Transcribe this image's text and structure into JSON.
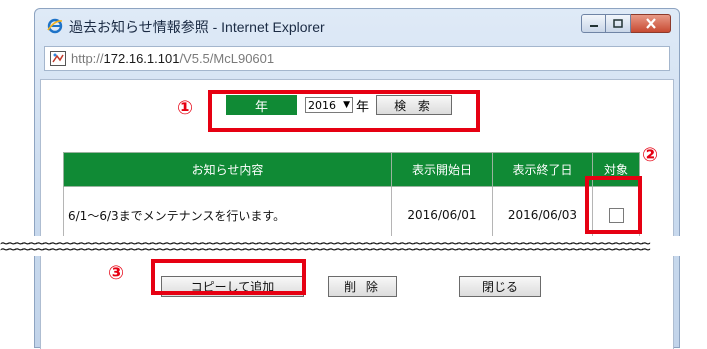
{
  "window": {
    "title": "過去お知らせ情報参照 - Internet Explorer",
    "url_prefix": "http://",
    "url_host": "172.16.1.101",
    "url_path": "/V5.5/McL90601"
  },
  "search": {
    "year_label": "年",
    "year_value": "2016",
    "year_suffix": "年",
    "search_button": "検 索"
  },
  "table": {
    "headers": [
      "お知らせ内容",
      "表示開始日",
      "表示終了日",
      "対象"
    ],
    "rows": [
      {
        "content": "6/1〜6/3までメンテナンスを行います。",
        "start": "2016/06/01",
        "end": "2016/06/03",
        "checked": false
      }
    ]
  },
  "buttons": {
    "copy_add": "コピーして追加",
    "delete": "削 除",
    "close": "閉じる"
  },
  "annotations": {
    "one": "①",
    "two": "②",
    "three": "③",
    "wave": "~~~~~~~~~~~~~~~~~~~~~~~~~~~~~~~~~~~~~~~~~~~~~~~~~~~~~~~~~~~~~~~~~~~~~~~~~~~~~~~~~~~~~~~~~~~"
  },
  "colors": {
    "accent_green": "#108a35",
    "annotation_red": "#e60012"
  },
  "icons": {
    "window_logo": "ie-logo-icon",
    "address": "page-icon",
    "minimize": "minimize-icon",
    "maximize": "maximize-icon",
    "close": "close-icon",
    "dropdown": "chevron-down-icon"
  }
}
